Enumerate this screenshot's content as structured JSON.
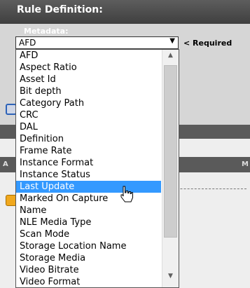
{
  "header": {
    "title": "Rule Definition:"
  },
  "metadata": {
    "label": "Metadata:",
    "selected_value": "AFD",
    "required_note": "< Required"
  },
  "dropdown": {
    "items": [
      "AFD",
      "Aspect Ratio",
      "Asset Id",
      "Bit depth",
      "Category Path",
      "CRC",
      "DAL",
      "Definition",
      "Frame Rate",
      "Instance Format",
      "Instance Status",
      "Last Update",
      "Marked On Capture",
      "Name",
      "NLE Media Type",
      "Scan Mode",
      "Storage Location Name",
      "Storage Media",
      "Video Bitrate",
      "Video Format"
    ],
    "highlighted_item": "Last Update"
  },
  "background": {
    "strip_left_letter": "A",
    "strip_right_letter": "M"
  },
  "colors": {
    "header": "#4a4a4a",
    "panel": "#d6d6d6",
    "selection": "#3399ff",
    "orange_button": "#f0a81e",
    "blue_button": "#2e63b8"
  },
  "icons": {
    "select_arrow": "triangle-down-icon",
    "scroll_up": "triangle-up-icon",
    "scroll_down": "triangle-down-icon",
    "pointer": "hand-cursor-icon"
  }
}
